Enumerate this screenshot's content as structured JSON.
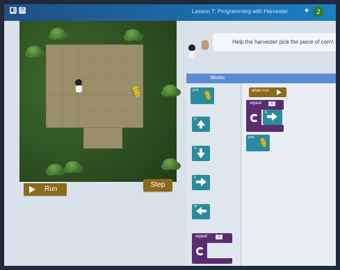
{
  "window": {
    "controls": [
      "◧",
      "?"
    ]
  },
  "lesson": {
    "title": "Lesson 7: Programming with Harvester",
    "number": "2"
  },
  "instruction": {
    "text": "Help the harvester pick the piece of corn!"
  },
  "game_controls": {
    "run_label": "Run",
    "step_label": "Step"
  },
  "panels": {
    "blocks_header": "Blocks"
  },
  "palette": {
    "pick_label": "pick",
    "north_label": "N",
    "south_label": "S",
    "east_label": "E",
    "west_label": "W",
    "repeat_label": "repeat",
    "repeat_count": "2"
  },
  "workspace": {
    "when_run_label": "when run",
    "repeat_label": "repeat",
    "repeat_count": "2",
    "inner_move_label": "E",
    "pick_label": "pick"
  },
  "colors": {
    "topbar": "#1c5f9e",
    "grass": "#2f5222",
    "dirt_tile": "#9b8f6a",
    "motion_block": "#2a8aa0",
    "loop_block": "#5a2d6e",
    "event_block": "#8c6a1d",
    "accent_blue": "#5a8bd4"
  }
}
